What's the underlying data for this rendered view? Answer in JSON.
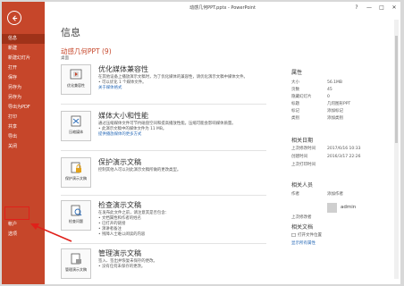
{
  "window": {
    "title": "动感几何PPT.pptx - PowerPoint",
    "controls": [
      "?",
      "—",
      "□",
      "✕"
    ]
  },
  "sidebar": {
    "items": [
      "信息",
      "新建",
      "新建幻灯片",
      "打开",
      "保存",
      "另存为",
      "另存为",
      "导出为PDF",
      "打印",
      "共享",
      "导出",
      "关闭"
    ],
    "bottom_items": [
      "帐户",
      "选项"
    ],
    "active_index": 0
  },
  "main": {
    "page_title": "信息",
    "doc_title": "动感几何PPT (9)",
    "doc_path": "桌面"
  },
  "sections": [
    {
      "button": "优化兼容性",
      "heading": "优化媒体兼容性",
      "lines": [
        "在其他设备上播放演示文稿时，为了优化媒体的兼容性，请优化演示文稿中媒体文件。",
        "• 可以优化 1 个媒体文件。"
      ],
      "link": "关于媒体格式"
    },
    {
      "button": "压缩媒体",
      "heading": "媒体大小和性能",
      "lines": [
        "通过压缩媒体文件可节约磁盘空间和提高播放性能。压缩可能会影响媒体质量。",
        "• 此演示文稿中的媒体文件为 11 MB。"
      ],
      "link": "提供播放媒体的更多方式"
    },
    {
      "button": "保护演示文稿",
      "heading": "保护演示文稿",
      "lines": [
        "控制其他人可以对此演示文稿所做的更改类型。"
      ],
      "link": ""
    },
    {
      "button": "检查问题",
      "heading": "检查演示文稿",
      "lines": [
        "在发布此文件之前，请注意其是否包含：",
        "• 文档属性和作者的姓名",
        "• 已打开的链接",
        "• 演讲者备注",
        "• 残障人士难以阅读的内容"
      ],
      "link": ""
    },
    {
      "button": "管理演示文稿",
      "heading": "管理演示文稿",
      "lines": [
        "签入、签出并恢复未保存的更改。",
        "• 没有任何未保存的更改。"
      ],
      "link": ""
    }
  ],
  "properties": {
    "heading": "属性",
    "rows": [
      {
        "k": "大小",
        "v": "56.1MB"
      },
      {
        "k": "页数",
        "v": "45"
      },
      {
        "k": "隐藏幻灯片",
        "v": "0"
      },
      {
        "k": "标题",
        "v": "几何图形PPT"
      },
      {
        "k": "标记",
        "v": "添加标记"
      },
      {
        "k": "类别",
        "v": "添加类别"
      }
    ]
  },
  "dates": {
    "heading": "相关日期",
    "rows": [
      {
        "k": "上次修改时间",
        "v": "2017/6/16 10:33"
      },
      {
        "k": "创建时间",
        "v": "2016/3/17 22:26"
      },
      {
        "k": "上次打印时间",
        "v": ""
      }
    ]
  },
  "people": {
    "heading": "相关人员",
    "rows": [
      {
        "k": "作者",
        "v": "添加作者"
      },
      {
        "k": "上次修改者",
        "v": ""
      }
    ],
    "author_name": "admin"
  },
  "related_docs": {
    "heading": "相关文档",
    "open_location": "打开文件位置",
    "show_all": "显示所有属性"
  },
  "colors": {
    "sidebar": "#c6462a",
    "sidebar_active": "#9f3219",
    "accent_title": "#c6462a",
    "link": "#2b6cb8",
    "annotation": "#e0201a"
  }
}
